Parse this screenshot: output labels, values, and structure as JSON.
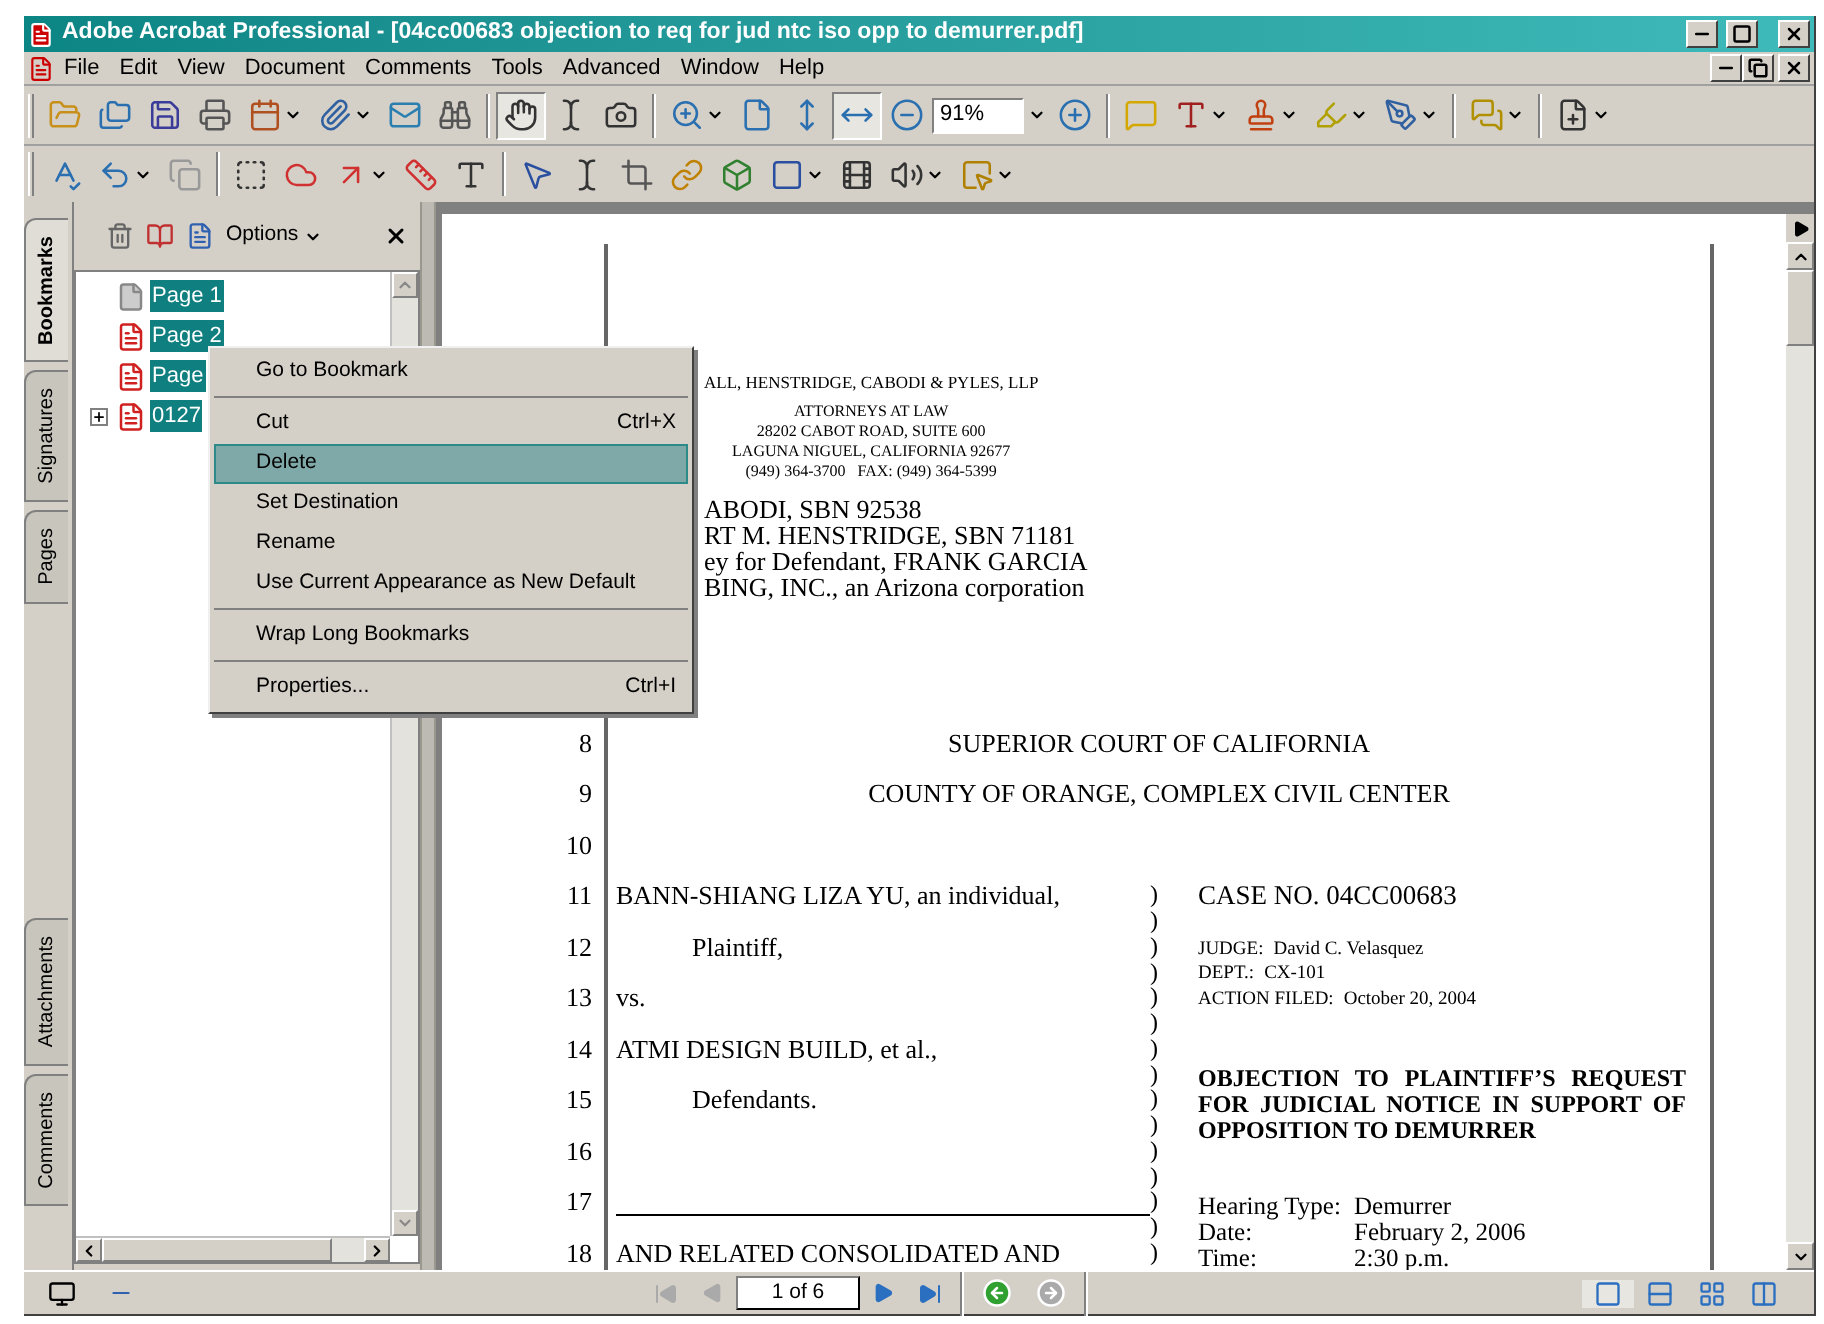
{
  "window": {
    "title": "Adobe Acrobat Professional - [04cc00683 objection to req for jud ntc iso opp to demurrer.pdf]"
  },
  "menu_bar": [
    {
      "label": "File"
    },
    {
      "label": "Edit"
    },
    {
      "label": "View"
    },
    {
      "label": "Document"
    },
    {
      "label": "Comments"
    },
    {
      "label": "Tools"
    },
    {
      "label": "Advanced"
    },
    {
      "label": "Window"
    },
    {
      "label": "Help"
    }
  ],
  "toolbar": {
    "zoom": "91%",
    "hand_tool": {
      "selected": true
    },
    "fit_width": {
      "selected": true
    }
  },
  "side_tabs_top": [
    {
      "label": "Bookmarks",
      "selected": true
    },
    {
      "label": "Signatures",
      "selected": false
    },
    {
      "label": "Pages",
      "selected": false
    }
  ],
  "side_tabs_bottom": [
    {
      "label": "Attachments",
      "selected": false
    },
    {
      "label": "Comments",
      "selected": false
    }
  ],
  "bookmarks_panel": {
    "options": "Options",
    "items": [
      {
        "label": "Page 1",
        "kind": "blank",
        "selected": true,
        "collapsed": false
      },
      {
        "label": "Page 2",
        "kind": "pdf",
        "selected": true,
        "collapsed": false
      },
      {
        "label": "Page",
        "kind": "pdf",
        "selected": true,
        "collapsed": false
      },
      {
        "label": "0127",
        "kind": "pdf",
        "selected": true,
        "collapsed": true
      }
    ]
  },
  "context_menu": {
    "groups": [
      [
        {
          "label": "Go to Bookmark",
          "selected": false
        }
      ],
      [
        {
          "label": "Cut",
          "shortcut": "Ctrl+X",
          "selected": false
        },
        {
          "label": "Delete",
          "selected": true
        },
        {
          "label": "Set Destination",
          "selected": false
        },
        {
          "label": "Rename",
          "selected": false
        },
        {
          "label": "Use Current Appearance as New Default",
          "selected": false
        }
      ],
      [
        {
          "label": "Wrap Long Bookmarks",
          "selected": false
        }
      ],
      [
        {
          "label": "Properties...",
          "shortcut": "Ctrl+I",
          "selected": false
        }
      ]
    ]
  },
  "document": {
    "firm": "ALL, HENSTRIDGE, CABODI & PYLES, LLP",
    "address": [
      "ATTORNEYS AT LAW",
      "28202 CABOT ROAD, SUITE 600",
      "LAGUNA NIGUEL, CALIFORNIA 92677",
      "(949) 364-3700   FAX: (949) 364-5399"
    ],
    "attorneys": [
      "ABODI, SBN 92538",
      "RT M. HENSTRIDGE, SBN 71181",
      "ey for Defendant, FRANK GARCIA",
      "BING, INC., an Arizona corporation"
    ],
    "court_lines": [
      {
        "number": "8",
        "text": "SUPERIOR COURT OF CALIFORNIA"
      },
      {
        "number": "9",
        "text": "COUNTY OF ORANGE, COMPLEX CIVIL CENTER"
      },
      {
        "number": "10"
      }
    ],
    "caption_lines": [
      {
        "number": "11",
        "kind": "party",
        "text": "BANN-SHIANG LIZA YU, an individual,"
      },
      {
        "number": "12",
        "kind": "role",
        "text": "Plaintiff,"
      },
      {
        "number": "13",
        "kind": "party",
        "text": "vs."
      },
      {
        "number": "14",
        "kind": "party",
        "text": "ATMI DESIGN BUILD, et al.,"
      },
      {
        "number": "15",
        "kind": "role",
        "text": "Defendants."
      },
      {
        "number": "16",
        "kind": "blank"
      },
      {
        "number": "17",
        "kind": "rule"
      },
      {
        "number": "18",
        "kind": "party",
        "text": "AND RELATED CONSOLIDATED AND"
      }
    ],
    "brackets": [
      ")",
      ")",
      ")",
      ")",
      ")",
      ")",
      ")",
      ")",
      ")",
      ")",
      ")",
      ")",
      ")",
      ")",
      ")"
    ],
    "case_no": "CASE NO. 04CC00683",
    "case_details": [
      {
        "label": "JUDGE:",
        "value": "David C. Velasquez"
      },
      {
        "label": "DEPT.:",
        "value": "CX-101"
      },
      {
        "label": "ACTION FILED:",
        "value": "October 20, 2004"
      }
    ],
    "title": "OBJECTION TO PLAINTIFF’S REQUEST FOR JUDICIAL NOTICE IN SUPPORT OF OPPOSITION TO DEMURRER",
    "hearing": [
      {
        "label": "Hearing Type:",
        "value": "Demurrer"
      },
      {
        "label": "Date:",
        "value": "February 2, 2006"
      },
      {
        "label": "Time:",
        "value": "2:30 p.m."
      }
    ]
  },
  "page_nav": {
    "page": "1 of 6"
  }
}
